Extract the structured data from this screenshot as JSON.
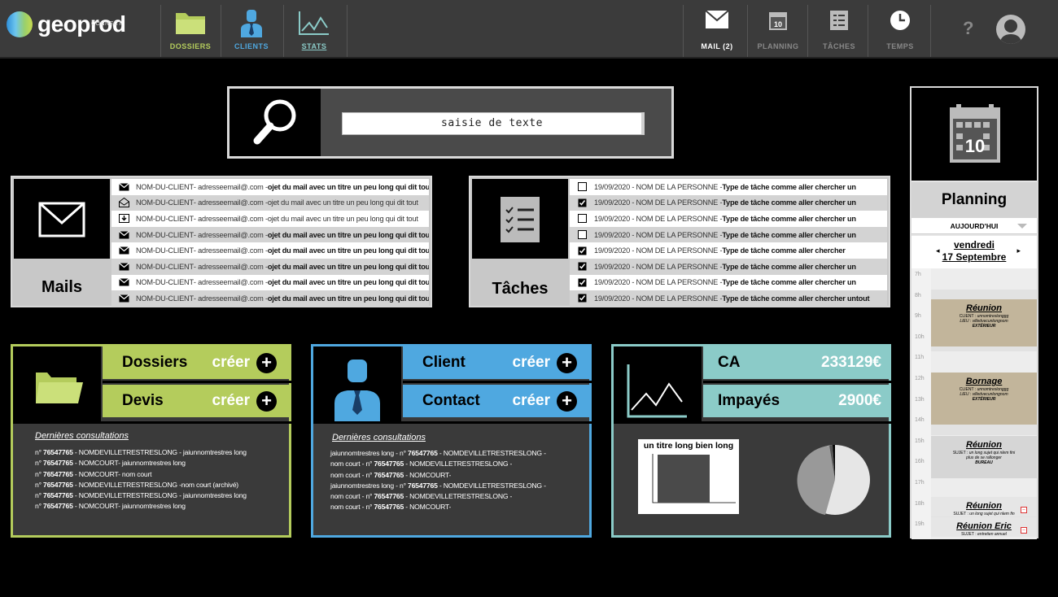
{
  "nav": {
    "logo_text": "geoprod",
    "logo_sub": "CONNECT",
    "left_items": [
      {
        "label": "DOSSIERS",
        "icon": "folder-icon",
        "color": "#b4cc5c"
      },
      {
        "label": "CLIENTS",
        "icon": "user-icon",
        "color": "#4fa8e0"
      },
      {
        "label": "STATS",
        "icon": "chart-icon",
        "color": "#8bcbc8"
      }
    ],
    "right_items": [
      {
        "label": "MAIL (2)",
        "icon": "mail-icon"
      },
      {
        "label": "PLANNING",
        "icon": "calendar-icon"
      },
      {
        "label": "TÂCHES",
        "icon": "tasks-icon"
      },
      {
        "label": "TEMPS",
        "icon": "clock-icon"
      }
    ],
    "help": "?"
  },
  "search": {
    "placeholder": "saisie de texte"
  },
  "mails": {
    "title": "Mails",
    "rows": [
      {
        "client": "NOM-DU-CLIENT",
        "email": " - adresseemail@.com - ",
        "subject": "ojet du mail avec un titre un peu long qui dit tout",
        "bold": true,
        "icon": "mail-closed-icon"
      },
      {
        "client": "NOM-DU-CLIENT",
        "email": " - adresseemail@.com - ",
        "subject": "ojet du mail avec un titre un peu long qui dit tout",
        "bold": false,
        "icon": "mail-open-icon"
      },
      {
        "client": "NOM-DU-CLIENT",
        "email": " - adresseemail@.com - ",
        "subject": "ojet du mail avec un titre un peu long qui dit tout",
        "bold": false,
        "icon": "mail-download-icon"
      },
      {
        "client": "NOM-DU-CLIENT",
        "email": " - adresseemail@.com - ",
        "subject": "ojet du mail avec un titre un peu long qui dit tout",
        "bold": true,
        "icon": "mail-closed-icon"
      },
      {
        "client": "NOM-DU-CLIENT",
        "email": " - adresseemail@.com - ",
        "subject": "ojet du mail avec un titre un peu long qui dit tout",
        "bold": true,
        "icon": "mail-closed-icon"
      },
      {
        "client": "NOM-DU-CLIENT",
        "email": " - adresseemail@.com - ",
        "subject": "ojet du mail avec un titre un peu long qui dit tout",
        "bold": true,
        "icon": "mail-closed-icon"
      },
      {
        "client": "NOM-DU-CLIENT",
        "email": " - adresseemail@.com - ",
        "subject": "ojet du mail avec un titre un peu long qui dit tout",
        "bold": true,
        "icon": "mail-closed-icon"
      },
      {
        "client": "NOM-DU-CLIENT",
        "email": " - adresseemail@.com - ",
        "subject": "ojet du mail avec un titre un peu long qui dit tout",
        "bold": true,
        "icon": "mail-closed-icon"
      }
    ]
  },
  "taches": {
    "title": "Tâches",
    "rows": [
      {
        "prefix": "19/09/2020 - NOM DE LA PERSONNE - ",
        "text": "Type de tâche comme aller chercher un",
        "checked": false
      },
      {
        "prefix": "19/09/2020 - NOM DE LA PERSONNE - ",
        "text": "Type de tâche comme aller chercher un",
        "checked": true
      },
      {
        "prefix": "19/09/2020 - NOM DE LA PERSONNE - ",
        "text": "Type de tâche comme aller chercher un",
        "checked": false
      },
      {
        "prefix": "19/09/2020 - NOM DE LA PERSONNE - ",
        "text": "Type de tâche comme aller chercher un",
        "checked": false
      },
      {
        "prefix": "19/09/2020 - NOM DE LA PERSONNE - ",
        "text": "Type de tâche comme aller chercher",
        "checked": true
      },
      {
        "prefix": "19/09/2020 - NOM DE LA PERSONNE - ",
        "text": "Type de tâche comme aller chercher un",
        "checked": true
      },
      {
        "prefix": "19/09/2020 - NOM DE LA PERSONNE - ",
        "text": "Type de tâche comme aller chercher un",
        "checked": true
      },
      {
        "prefix": "19/09/2020 - NOM DE LA PERSONNE - ",
        "text": "Type de tâche comme aller chercher untout",
        "checked": true
      }
    ]
  },
  "dossiers_card": {
    "color": "#b4cc5c",
    "bar1": "Dossiers",
    "bar2": "Devis",
    "action": "créer",
    "consult_title": "Dernières consultations",
    "lines": [
      {
        "a": "n° ",
        "b": "76547765",
        "c": " - NOMDEVILLETRESTRESLONG - jaiunnomtrestres long"
      },
      {
        "a": "n° ",
        "b": "76547765",
        "c": " - NOMCOURT- jaiunnomtrestres long"
      },
      {
        "a": "n° ",
        "b": "76547765",
        "c": " - NOMCOURT- nom court"
      },
      {
        "a": "n° ",
        "b": "76547765",
        "c": " - NOMDEVILLETRESTRESLONG -nom court (archivé)"
      },
      {
        "a": "n° ",
        "b": "76547765",
        "c": " - NOMDEVILLETRESTRESLONG - jaiunnomtrestres long"
      },
      {
        "a": "n° ",
        "b": "76547765",
        "c": " - NOMCOURT- jaiunnomtrestres long"
      }
    ]
  },
  "clients_card": {
    "color": "#4fa8e0",
    "bar1": "Client",
    "bar2": "Contact",
    "action": "créer",
    "consult_title": "Dernières consultations",
    "lines": [
      {
        "a": "jaiunnomtrestres long - n° ",
        "b": "76547765",
        "c": " - NOMDEVILLETRESTRESLONG -"
      },
      {
        "a": "nom court - n° ",
        "b": "76547765",
        "c": " - NOMDEVILLETRESTRESLONG -"
      },
      {
        "a": "nom court - n° ",
        "b": "76547765",
        "c": " - NOMCOURT-"
      },
      {
        "a": "jaiunnomtrestres long - n° ",
        "b": "76547765",
        "c": " - NOMDEVILLETRESTRESLONG -"
      },
      {
        "a": "nom court - n° ",
        "b": "76547765",
        "c": " - NOMDEVILLETRESTRESLONG -"
      },
      {
        "a": "nom court - n° ",
        "b": "76547765",
        "c": " - NOMCOURT-"
      }
    ]
  },
  "stats_card": {
    "color": "#8bcbc8",
    "bar1": "CA",
    "bar1_value": "233129€",
    "bar2": "Impayés",
    "bar2_value": "2900€",
    "mini_chart_title": "un titre long bien long"
  },
  "planning": {
    "title": "Planning",
    "today": "AUJOURD'HUI",
    "day": "vendredi",
    "date": "17 Septembre",
    "calendar_day": "10",
    "hours": [
      "7h",
      "8h",
      "9h",
      "10h",
      "11h",
      "12h",
      "13h",
      "14h",
      "15h",
      "16h",
      "17h",
      "18h",
      "19h"
    ],
    "events": [
      {
        "title": "Réunion",
        "l1a": "CLIENT : ",
        "l1b": "unnomtreslonggg",
        "l2a": "LIEU : ",
        "l2b": "villedvecunlongnom",
        "l3": "EXTÉRIEUR",
        "color": "#c2b59b"
      },
      {
        "title": "Bornage",
        "l1a": "CLIENT : ",
        "l1b": "unnomtreslonggg",
        "l2a": "LIEU : ",
        "l2b": "villedvecunlongnom",
        "l3": "EXTÉRIEUR",
        "color": "#c2b59b"
      },
      {
        "title": "Réunion",
        "l1a": "SUJET : ",
        "l1b": "un long sujet qui nlem fini",
        "l2a": "",
        "l2b": "plus de se rallonger",
        "l3": "BUREAU",
        "color": "#d6d6d6"
      },
      {
        "title": "Réunion",
        "l1a": "SUJET : ",
        "l1b": "un long sujet qui nlem fin",
        "l2a": "",
        "l2b": "",
        "l3": "",
        "color": "#e6e6e6"
      },
      {
        "title": "Réunion Eric",
        "l1a": "SUJET : ",
        "l1b": "entretien annuel",
        "l2a": "",
        "l2b": "",
        "l3": "",
        "color": "#e6e6e6"
      }
    ]
  }
}
